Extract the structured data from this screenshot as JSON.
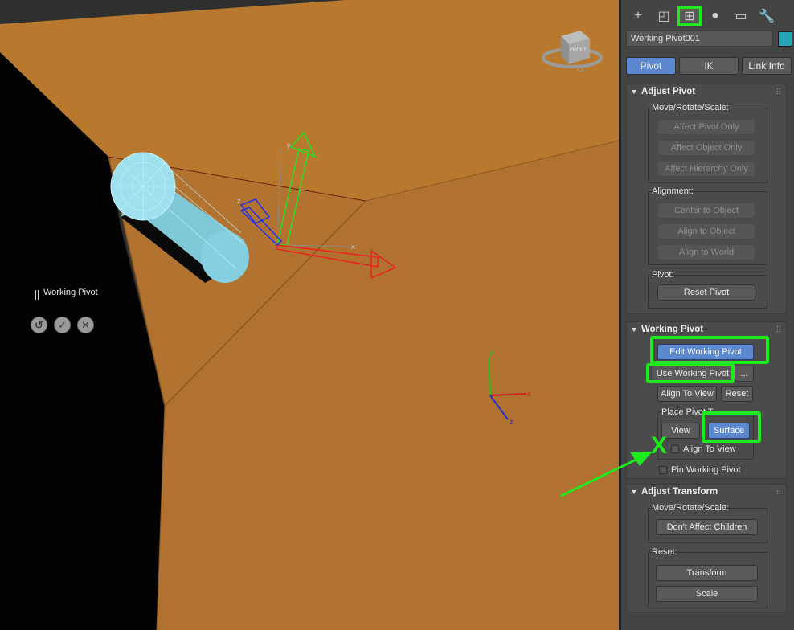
{
  "viewport": {
    "working_pivot_label": "Working Pivot",
    "buttons": [
      {
        "icon": "undo-icon",
        "glyph": "↺"
      },
      {
        "icon": "checkmark-icon",
        "glyph": "✓"
      },
      {
        "icon": "cancel-icon",
        "glyph": "✕"
      }
    ],
    "gizmo_labels": {
      "x": "x",
      "y": "y",
      "z": "z"
    },
    "viewcube_label": "FRONT"
  },
  "command_panel": {
    "top_tabs": [
      {
        "icon": "create-icon",
        "glyph": "+"
      },
      {
        "icon": "modify-icon",
        "glyph": "◰"
      },
      {
        "icon": "hierarchy-icon",
        "glyph": "⊞",
        "active": true
      },
      {
        "icon": "motion-icon",
        "glyph": "●"
      },
      {
        "icon": "display-icon",
        "glyph": "▭"
      },
      {
        "icon": "utilities-icon",
        "glyph": "🔧"
      }
    ],
    "object_name": "Working Pivot001",
    "object_color": "#28a5b4",
    "sub_tabs": [
      "Pivot",
      "IK",
      "Link Info"
    ],
    "active_sub_tab": "Pivot",
    "adjust_pivot": {
      "title": "Adjust Pivot",
      "move_group_label": "Move/Rotate/Scale:",
      "affect_pivot_only": "Affect Pivot Only",
      "affect_object_only": "Affect Object Only",
      "affect_hierarchy_only": "Affect Hierarchy Only",
      "alignment_label": "Alignment:",
      "center_to_object": "Center to Object",
      "align_to_object": "Align to Object",
      "align_to_world": "Align to World",
      "pivot_label": "Pivot:",
      "reset_pivot": "Reset Pivot"
    },
    "working_pivot": {
      "title": "Working Pivot",
      "edit_working_pivot": "Edit Working Pivot",
      "use_working_pivot": "Use Working Pivot",
      "more": "...",
      "align_to_view": "Align To View",
      "reset": "Reset",
      "place_pivot_label": "Place Pivot T",
      "view": "View",
      "surface": "Surface",
      "align_to_view_check": "Align To View",
      "pin_working_pivot": "Pin Working Pivot"
    },
    "adjust_transform": {
      "title": "Adjust Transform",
      "move_group_label": "Move/Rotate/Scale:",
      "dont_affect_children": "Don't Affect Children",
      "reset_label": "Reset:",
      "transform": "Transform",
      "scale": "Scale"
    }
  },
  "annotation": {
    "color": "#1eea1e",
    "x_mark": "X"
  }
}
